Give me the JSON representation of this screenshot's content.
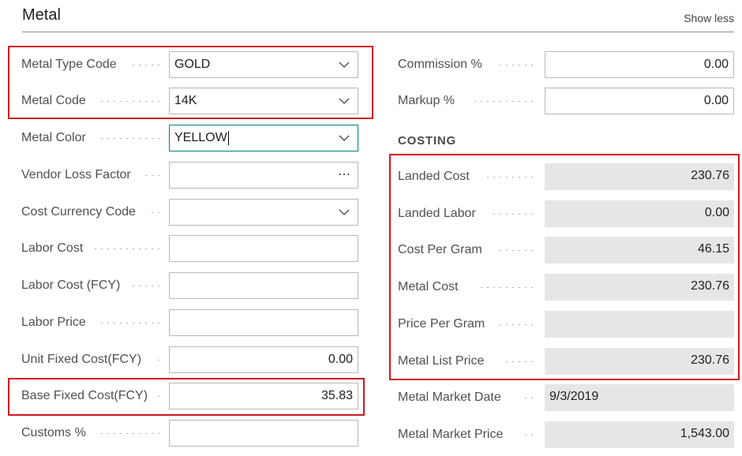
{
  "header": {
    "title": "Metal",
    "toggle_label": "Show less"
  },
  "left_fields": [
    {
      "label": "Metal Type Code",
      "value": "GOLD",
      "kind": "select"
    },
    {
      "label": "Metal Code",
      "value": "14K",
      "kind": "select"
    },
    {
      "label": "Metal Color",
      "value": "YELLOW",
      "kind": "select"
    },
    {
      "label": "Vendor Loss Factor",
      "value": "",
      "kind": "lookup"
    },
    {
      "label": "Cost Currency Code",
      "value": "",
      "kind": "select"
    },
    {
      "label": "Labor Cost",
      "value": "",
      "kind": "text"
    },
    {
      "label": "Labor Cost (FCY)",
      "value": "",
      "kind": "text"
    },
    {
      "label": "Labor Price",
      "value": "",
      "kind": "text"
    },
    {
      "label": "Unit Fixed Cost(FCY)",
      "value": "0.00",
      "kind": "number"
    },
    {
      "label": "Base Fixed Cost(FCY)",
      "value": "35.83",
      "kind": "number"
    },
    {
      "label": "Customs %",
      "value": "",
      "kind": "text"
    }
  ],
  "right_top_fields": [
    {
      "label": "Commission %",
      "value": "0.00"
    },
    {
      "label": "Markup %",
      "value": "0.00"
    }
  ],
  "costing": {
    "heading": "COSTING",
    "fields": [
      {
        "label": "Landed Cost",
        "value": "230.76"
      },
      {
        "label": "Landed Labor",
        "value": "0.00"
      },
      {
        "label": "Cost Per Gram",
        "value": "46.15"
      },
      {
        "label": "Metal Cost",
        "value": "230.76"
      },
      {
        "label": "Price Per Gram",
        "value": ""
      },
      {
        "label": "Metal List Price",
        "value": "230.76"
      },
      {
        "label": "Metal Market Date",
        "value": "9/3/2019"
      },
      {
        "label": "Metal Market Price",
        "value": "1,543.00"
      }
    ]
  },
  "icons": {
    "dropdown": "chevron-down-icon",
    "lookup": "ellipsis-icon"
  },
  "colors": {
    "highlight": "#d0181f",
    "focus_border": "#00807a",
    "readonly_bg": "#e6e6e6"
  }
}
